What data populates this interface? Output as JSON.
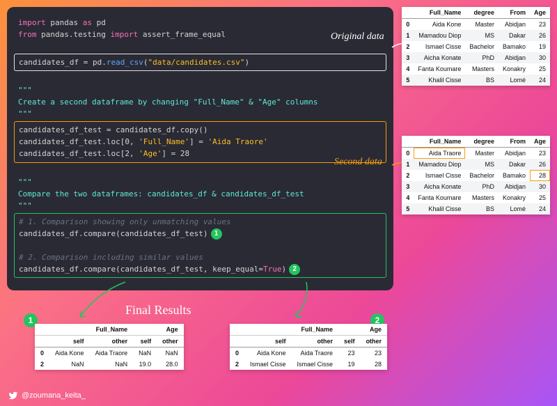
{
  "code": {
    "l1a": "import",
    "l1b": " pandas ",
    "l1c": "as",
    "l1d": " pd",
    "l2a": "from",
    "l2b": " pandas.testing ",
    "l2c": "import",
    "l2d": " assert_frame_equal",
    "l4": "candidates_df = pd.read_csv(\"data/candidates.csv\")",
    "l4_var": "candidates_df ",
    "l4_eq": "= pd.",
    "l4_fn": "read_csv",
    "l4_op": "(",
    "l4_str": "\"data/candidates.csv\"",
    "l4_cl": ")",
    "doc1a": "\"\"\"",
    "doc1b": "Create a second dataframe by changing \"Full_Name\" & \"Age\" columns",
    "doc1c": "\"\"\"",
    "l8": "candidates_df_test = candidates_df.copy()",
    "l9a": "candidates_df_test.loc[",
    "l9b": "0",
    "l9c": ", ",
    "l9d": "'Full_Name'",
    "l9e": "] = ",
    "l9f": "'Aida Traore'",
    "l10a": "candidates_df_test.loc[",
    "l10b": "2",
    "l10c": ", ",
    "l10d": "'Age'",
    "l10e": "] = ",
    "l10f": "28",
    "doc2a": "\"\"\"",
    "doc2b": "Compare the two dataframes: candidates_df & candidates_df_test",
    "doc2c": "\"\"\"",
    "c1": "# 1. Comparison showing only unmatching values",
    "l15": "candidates_df.compare(candidates_df_test)",
    "c2": "# 2. Comparison including similar values",
    "l17a": "candidates_df.compare(candidates_df_test, ",
    "l17b": "keep_equal",
    "l17c": "=",
    "l17d": "True",
    "l17e": ")"
  },
  "labels": {
    "original": "Original data",
    "second": "Second data",
    "final": "Final Results",
    "badge1": "1",
    "badge2": "2"
  },
  "table_headers": [
    "",
    "Full_Name",
    "degree",
    "From",
    "Age"
  ],
  "original_rows": [
    [
      "0",
      "Aida Kone",
      "Master",
      "Abidjan",
      "23"
    ],
    [
      "1",
      "Mamadou Diop",
      "MS",
      "Dakar",
      "26"
    ],
    [
      "2",
      "Ismael Cisse",
      "Bachelor",
      "Bamako",
      "19"
    ],
    [
      "3",
      "Aicha Konate",
      "PhD",
      "Abidjan",
      "30"
    ],
    [
      "4",
      "Fanta Koumare",
      "Masters",
      "Konakry",
      "25"
    ],
    [
      "5",
      "Khalil Cisse",
      "BS",
      "Lomé",
      "24"
    ]
  ],
  "second_rows": [
    [
      "0",
      "Aida Traore",
      "Master",
      "Abidjan",
      "23"
    ],
    [
      "1",
      "Mamadou Diop",
      "MS",
      "Dakar",
      "26"
    ],
    [
      "2",
      "Ismael Cisse",
      "Bachelor",
      "Bamako",
      "28"
    ],
    [
      "3",
      "Aicha Konate",
      "PhD",
      "Abidjan",
      "30"
    ],
    [
      "4",
      "Fanta Koumare",
      "Masters",
      "Konakry",
      "25"
    ],
    [
      "5",
      "Khalil Cisse",
      "BS",
      "Lomé",
      "24"
    ]
  ],
  "result1": {
    "top": [
      "",
      "Full_Name",
      "",
      "Age",
      ""
    ],
    "sub": [
      "",
      "self",
      "other",
      "self",
      "other"
    ],
    "rows": [
      [
        "0",
        "Aida Kone",
        "Aida Traore",
        "NaN",
        "NaN"
      ],
      [
        "2",
        "NaN",
        "NaN",
        "19.0",
        "28.0"
      ]
    ]
  },
  "result2": {
    "top": [
      "",
      "Full_Name",
      "",
      "Age",
      ""
    ],
    "sub": [
      "",
      "self",
      "other",
      "self",
      "other"
    ],
    "rows": [
      [
        "0",
        "Aida Kone",
        "Aida Traore",
        "23",
        "23"
      ],
      [
        "2",
        "Ismael Cisse",
        "Ismael Cisse",
        "19",
        "28"
      ]
    ]
  },
  "twitter": "@zoumana_keita_"
}
